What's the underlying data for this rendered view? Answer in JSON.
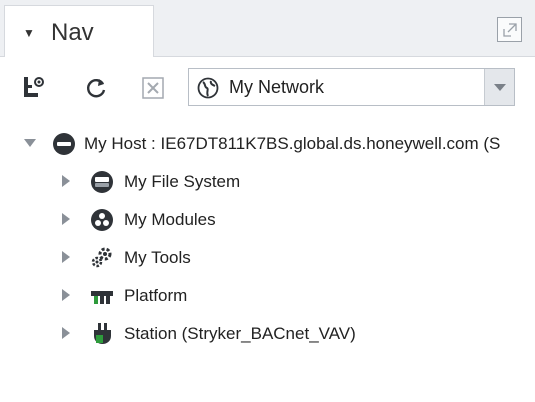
{
  "panel": {
    "tab_label": "Nav"
  },
  "toolbar": {
    "network_select_value": "My Network"
  },
  "tree": {
    "host_label": "My Host : IE67DT811K7BS.global.ds.honeywell.com (S",
    "children": [
      {
        "label": "My File System",
        "icon": "file-system-icon"
      },
      {
        "label": "My Modules",
        "icon": "modules-icon"
      },
      {
        "label": "My Tools",
        "icon": "tools-icon"
      },
      {
        "label": "Platform",
        "icon": "platform-icon"
      },
      {
        "label": "Station (Stryker_BACnet_VAV)",
        "icon": "station-icon"
      }
    ]
  },
  "colors": {
    "icon_dark": "#2f3338",
    "accent_green": "#2e9b3c",
    "expander_gray": "#8a9098"
  }
}
